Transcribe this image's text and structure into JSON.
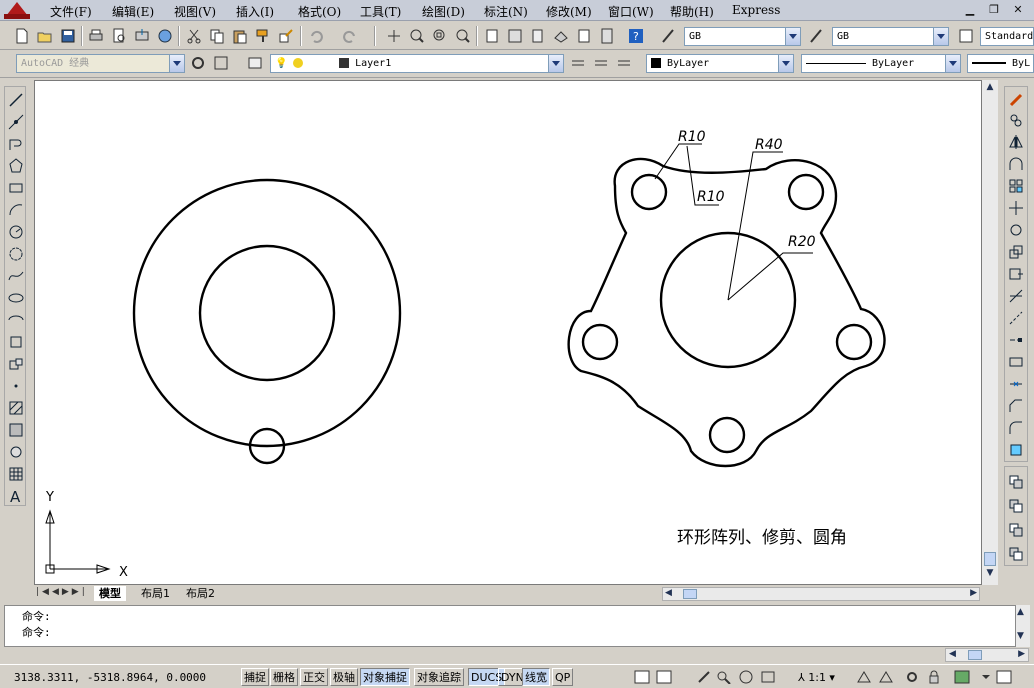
{
  "menubar": {
    "items": [
      "文件(F)",
      "编辑(E)",
      "视图(V)",
      "插入(I)",
      "格式(O)",
      "工具(T)",
      "绘图(D)",
      "标注(N)",
      "修改(M)",
      "窗口(W)",
      "帮助(H)",
      "Express"
    ]
  },
  "toolbar": {
    "dimstyle": "GB",
    "tablestyle": "GB",
    "textstyle": "Standard",
    "workspace": "AutoCAD 经典",
    "layer": "Layer1",
    "color": "ByLayer",
    "linetype": "ByLayer",
    "lineweight": "ByL"
  },
  "drawing": {
    "labels": {
      "r10_top": "R10",
      "r10_side": "R10",
      "r40": "R40",
      "r20": "R20",
      "caption": "环形阵列、修剪、圆角",
      "ucs_y": "Y",
      "ucs_x": "X"
    }
  },
  "tabs": [
    "模型",
    "布局1",
    "布局2"
  ],
  "command": {
    "line1": "命令:",
    "line2": "命令:"
  },
  "status": {
    "coords": "3138.3311, -5318.8964, 0.0000",
    "toggles": [
      {
        "label": "捕捉",
        "on": false
      },
      {
        "label": "栅格",
        "on": false
      },
      {
        "label": "正交",
        "on": false
      },
      {
        "label": "极轴",
        "on": false
      },
      {
        "label": "对象捕捉",
        "on": true
      },
      {
        "label": "对象追踪",
        "on": false
      },
      {
        "label": "DUCS",
        "on": true
      },
      {
        "label": "DYN",
        "on": false
      },
      {
        "label": "线宽",
        "on": true
      },
      {
        "label": "QP",
        "on": false
      }
    ],
    "annotation_scale": "1:1"
  }
}
